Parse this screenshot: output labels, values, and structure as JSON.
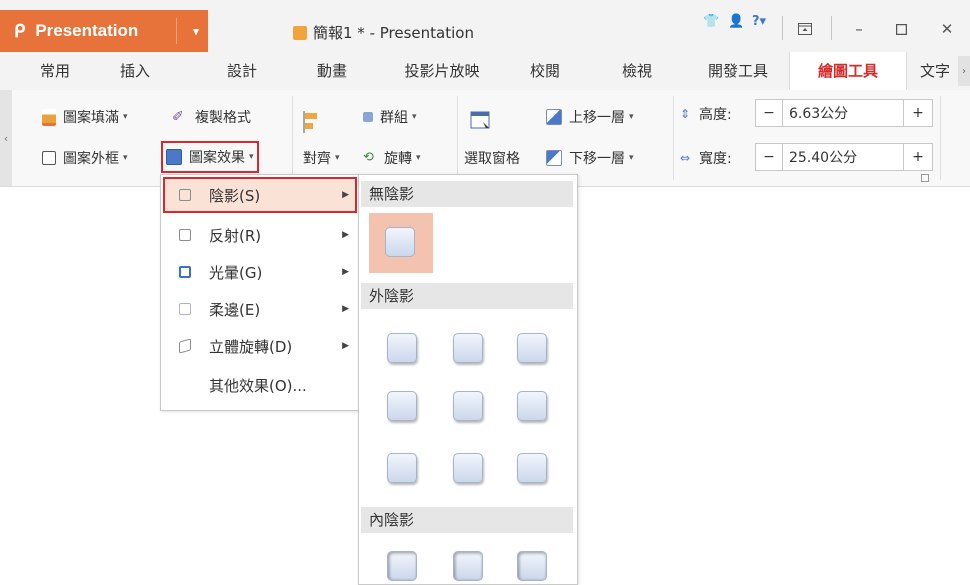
{
  "title_bar": {
    "app_label": "Presentation",
    "doc_title": "簡報1 * - Presentation"
  },
  "tabs": [
    "常用",
    "插入",
    "設計",
    "動畫",
    "投影片放映",
    "校閱",
    "檢視",
    "開發工具",
    "繪圖工具",
    "文字"
  ],
  "active_tab": "繪圖工具",
  "toolbar": {
    "fill": "圖案填滿",
    "copy_format": "複製格式",
    "outline": "圖案外框",
    "effects": "圖案效果",
    "align": "對齊",
    "group": "群組",
    "rotate": "旋轉",
    "selection_pane": "選取窗格",
    "bring_forward": "上移一層",
    "send_backward": "下移一層",
    "height_label": "高度:",
    "height_value": "6.63公分",
    "width_label": "寬度:",
    "width_value": "25.40公分"
  },
  "effects_menu": {
    "items": [
      {
        "label": "陰影(S)",
        "has_submenu": true
      },
      {
        "label": "反射(R)",
        "has_submenu": true
      },
      {
        "label": "光暈(G)",
        "has_submenu": true
      },
      {
        "label": "柔邊(E)",
        "has_submenu": true
      },
      {
        "label": "立體旋轉(D)",
        "has_submenu": true
      },
      {
        "label": "其他效果(O)...",
        "has_submenu": false
      }
    ]
  },
  "shadow_submenu": {
    "no_shadow": "無陰影",
    "outer_shadow": "外陰影",
    "inner_shadow": "內陰影"
  },
  "colors": {
    "accent": "#e8733a",
    "active_tab_text": "#d62b2b",
    "highlight_border": "#d8282f",
    "hover_fill": "#fbe2d7",
    "no_shadow_fill": "#f3c3b0"
  }
}
